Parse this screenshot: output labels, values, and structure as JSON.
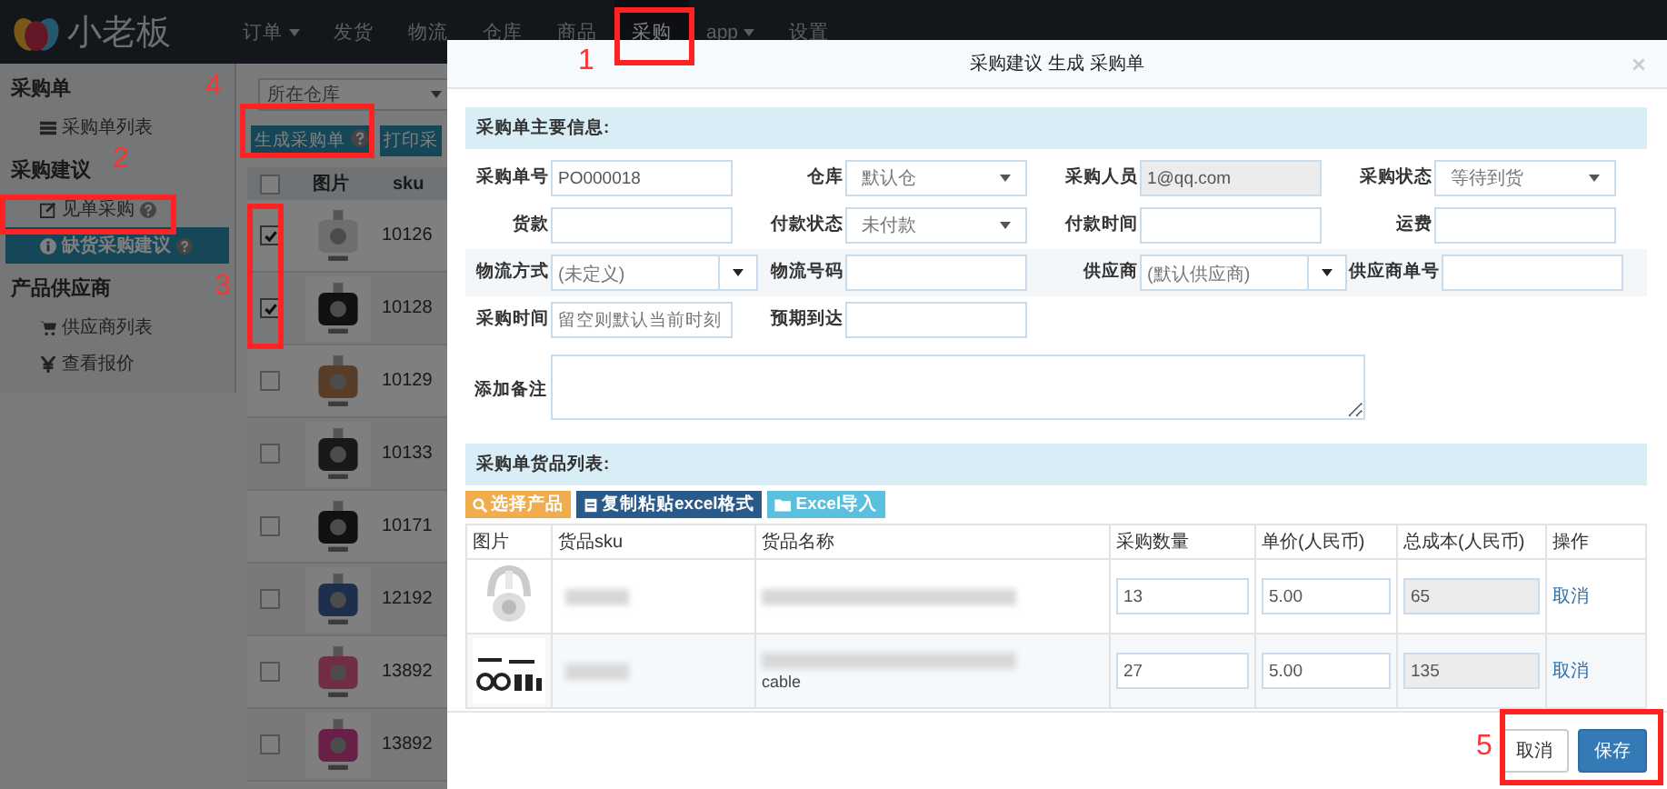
{
  "nav": {
    "logo": "小老板",
    "items": [
      {
        "label": "订单",
        "dropdown": true,
        "selected": false
      },
      {
        "label": "发货",
        "dropdown": false,
        "selected": false
      },
      {
        "label": "物流",
        "dropdown": false,
        "selected": false
      },
      {
        "label": "仓库",
        "dropdown": false,
        "selected": false
      },
      {
        "label": "商品",
        "dropdown": false,
        "selected": false
      },
      {
        "label": "采购",
        "dropdown": false,
        "selected": true
      },
      {
        "label": "app",
        "dropdown": true,
        "selected": false
      },
      {
        "label": "设置",
        "dropdown": false,
        "selected": false
      }
    ]
  },
  "sidebar": {
    "groups": [
      {
        "title": "采购单",
        "items": [
          {
            "label": "采购单列表",
            "kind": "list",
            "help": false,
            "selected": false
          }
        ]
      },
      {
        "title": "采购建议",
        "items": [
          {
            "label": "见单采购",
            "kind": "edit",
            "help": true,
            "selected": false
          },
          {
            "label": "缺货采购建议",
            "kind": "info",
            "help": true,
            "selected": true
          }
        ]
      },
      {
        "title": "产品供应商",
        "items": [
          {
            "label": "供应商列表",
            "kind": "cart",
            "help": false,
            "selected": false
          },
          {
            "label": "查看报价",
            "kind": "yen",
            "help": false,
            "selected": false
          }
        ]
      }
    ]
  },
  "background": {
    "warehouse_select": "所在仓库",
    "buttons": [
      {
        "label": "生成采购单",
        "help": true
      },
      {
        "label": "打印采",
        "help": false
      }
    ],
    "select_all_checked": false,
    "columns": [
      "图片",
      "sku"
    ],
    "rows": [
      {
        "checked": true,
        "sku": "10126"
      },
      {
        "checked": true,
        "sku": "10128"
      },
      {
        "checked": false,
        "sku": "10129"
      },
      {
        "checked": false,
        "sku": "10133"
      },
      {
        "checked": false,
        "sku": "10171"
      },
      {
        "checked": false,
        "sku": "12192"
      },
      {
        "checked": false,
        "sku": "13892"
      },
      {
        "checked": false,
        "sku": "13892"
      }
    ]
  },
  "modal": {
    "title": "采购建议 生成 采购单",
    "main_section": "采购单主要信息:",
    "form_rows": [
      {
        "shaded": false,
        "fields": [
          {
            "label": "采购单号",
            "kind": "text",
            "value": "PO000018"
          },
          {
            "label": "仓库",
            "kind": "select",
            "value": "默认仓"
          },
          {
            "label": "采购人员",
            "kind": "disabled",
            "value": "1@qq.com"
          },
          {
            "label": "采购状态",
            "kind": "select",
            "value": "等待到货"
          }
        ]
      },
      {
        "shaded": false,
        "fields": [
          {
            "label": "货款",
            "kind": "text"
          },
          {
            "label": "付款状态",
            "kind": "select",
            "value": "未付款"
          },
          {
            "label": "付款时间",
            "kind": "text"
          },
          {
            "label": "运费",
            "kind": "text"
          }
        ]
      },
      {
        "shaded": true,
        "fields": [
          {
            "label": "物流方式",
            "kind": "combo",
            "value": "(未定义)"
          },
          {
            "label": "物流号码",
            "kind": "text"
          },
          {
            "label": "供应商",
            "kind": "combo",
            "value": "(默认供应商)"
          },
          {
            "label": "供应商单号",
            "kind": "text"
          }
        ]
      },
      {
        "shaded": false,
        "fields": [
          {
            "label": "采购时间",
            "kind": "text",
            "placeholder": "留空则默认当前时刻"
          },
          {
            "label": "预期到达",
            "kind": "text"
          }
        ]
      }
    ],
    "note_label": "添加备注",
    "items_section": "采购单货品列表:",
    "tool_buttons": [
      {
        "label": "选择产品",
        "kind": "search"
      },
      {
        "label": "复制粘贴excel格式",
        "kind": "paste"
      },
      {
        "label": "Excel导入",
        "kind": "import"
      }
    ],
    "columns": [
      "图片",
      "货品sku",
      "货品名称",
      "采购数量",
      "单价(人民币)",
      "总成本(人民币)",
      "操作"
    ],
    "rows": [
      {
        "quantity": "13",
        "price": "5.00",
        "total": "65",
        "action": "取消"
      },
      {
        "quantity": "27",
        "price": "5.00",
        "total": "135",
        "action": "取消",
        "name_fragment": "cable"
      }
    ],
    "footer_buttons": [
      {
        "label": "取消",
        "primary": false
      },
      {
        "label": "保存",
        "primary": true
      }
    ]
  },
  "annotations": [
    "1",
    "2",
    "3",
    "4",
    "5"
  ]
}
